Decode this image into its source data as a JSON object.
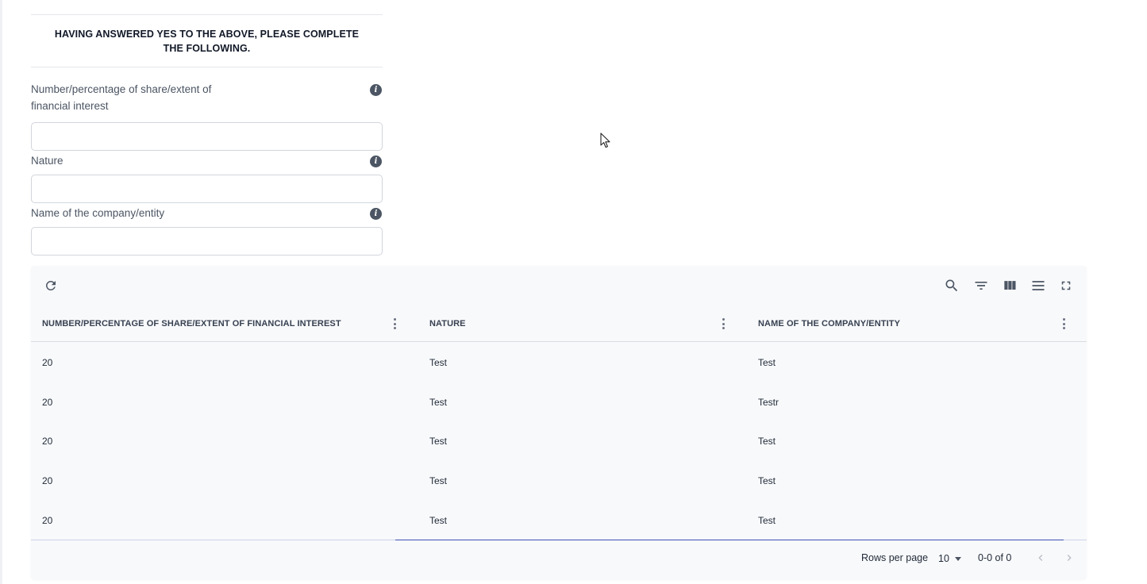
{
  "form": {
    "heading": "HAVING ANSWERED YES TO THE ABOVE, PLEASE COMPLETE THE FOLLOWING.",
    "fields": [
      {
        "label": "Number/percentage of share/extent of financial interest",
        "value": "",
        "placeholder": ""
      },
      {
        "label": "Nature",
        "value": "",
        "placeholder": ""
      },
      {
        "label": "Name of the company/entity",
        "value": "",
        "placeholder": ""
      }
    ]
  },
  "toolbar": {
    "refresh_icon": "refresh-icon",
    "search_icon": "search-icon",
    "filter_icon": "filter-icon",
    "columns_icon": "view-column-icon",
    "density_icon": "density-icon",
    "fullscreen_icon": "fullscreen-icon"
  },
  "table": {
    "columns": [
      "NUMBER/PERCENTAGE OF SHARE/EXTENT OF FINANCIAL INTEREST",
      "NATURE",
      "NAME OF THE COMPANY/ENTITY"
    ],
    "rows": [
      [
        "20",
        "Test",
        "Test"
      ],
      [
        "20",
        "Test",
        "Testr"
      ],
      [
        "20",
        "Test",
        "Test"
      ],
      [
        "20",
        "Test",
        "Test"
      ],
      [
        "20",
        "Test",
        "Test"
      ]
    ]
  },
  "pagination": {
    "rows_per_page_label": "Rows per page",
    "rows_per_page_value": "10",
    "range_text": "0-0 of 0"
  },
  "colors": {
    "accent": "#3f51b5",
    "grid_bg": "#f8f9fb",
    "icon": "#4b5563"
  }
}
